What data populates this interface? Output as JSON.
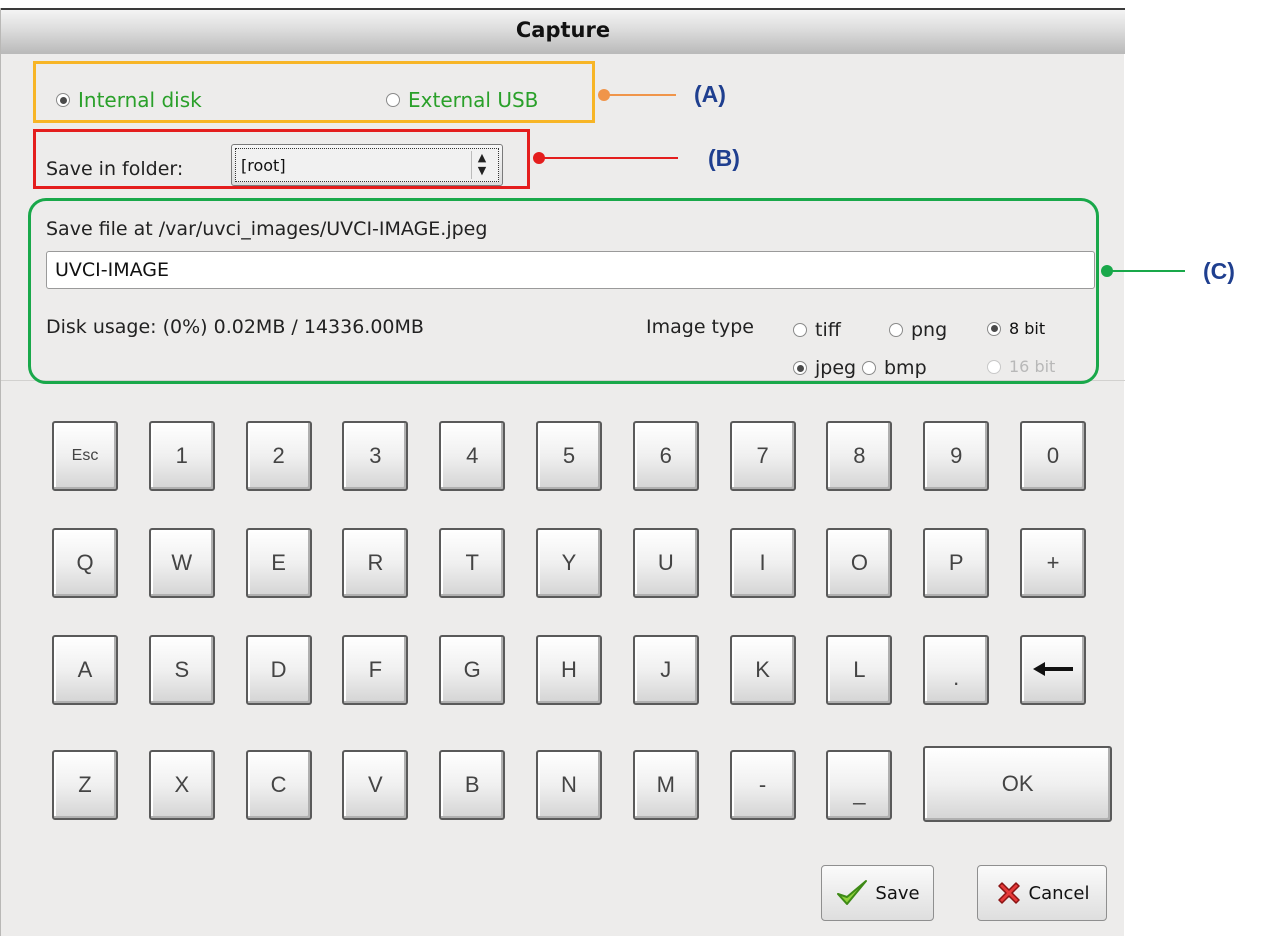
{
  "window": {
    "title": "Capture"
  },
  "storage": {
    "internal_label": "Internal disk",
    "external_label": "External USB",
    "selected": "internal"
  },
  "folder": {
    "label": "Save in folder:",
    "value": "[root]"
  },
  "file": {
    "path_label": "Save file at /var/uvci_images/UVCI-IMAGE.jpeg",
    "name_value": "UVCI-IMAGE",
    "disk_usage": "Disk usage: (0%) 0.02MB / 14336.00MB"
  },
  "image_type": {
    "label": "Image type",
    "tiff": "tiff",
    "png": "png",
    "jpeg": "jpeg",
    "bmp": "bmp",
    "bit8": "8 bit",
    "bit16": "16 bit",
    "selected_format": "jpeg",
    "selected_depth": "8 bit"
  },
  "callouts": {
    "a": "(A)",
    "b": "(B)",
    "c": "(C)"
  },
  "keyboard": {
    "rows": [
      [
        "Esc",
        "1",
        "2",
        "3",
        "4",
        "5",
        "6",
        "7",
        "8",
        "9",
        "0"
      ],
      [
        "Q",
        "W",
        "E",
        "R",
        "T",
        "Y",
        "U",
        "I",
        "O",
        "P",
        "+"
      ],
      [
        "A",
        "S",
        "D",
        "F",
        "G",
        "H",
        "J",
        "K",
        "L",
        ".",
        "backspace"
      ],
      [
        "Z",
        "X",
        "C",
        "V",
        "B",
        "N",
        "M",
        "-",
        "_",
        "OK"
      ]
    ]
  },
  "buttons": {
    "save": "Save",
    "cancel": "Cancel"
  },
  "colors": {
    "box_a": "#f7b526",
    "box_b": "#e41d1d",
    "box_c": "#19a84a",
    "leader_a": "#f0954a",
    "callout_text": "#1f3f8f",
    "option_text": "#2aa02a"
  }
}
